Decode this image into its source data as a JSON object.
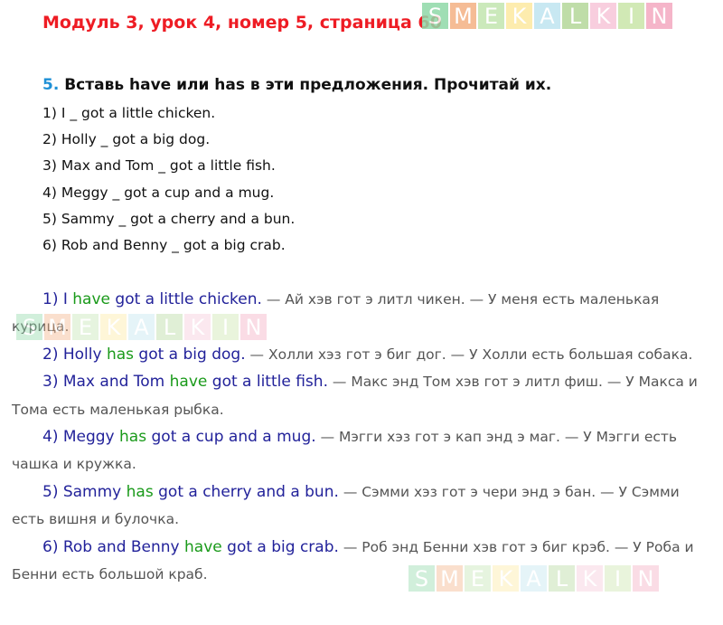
{
  "header": {
    "title": "Модуль 3, урок 4, номер 5, страница 60"
  },
  "watermark": {
    "letters": [
      "S",
      "M",
      "E",
      "K",
      "A",
      "L",
      "K",
      "I",
      "N"
    ],
    "colors": [
      "#8fd9a8",
      "#f4b183",
      "#c3e6b0",
      "#fde9a0",
      "#bfe4f0",
      "#b4d89a",
      "#f7c6d9",
      "#c9e6a9",
      "#f4a9c0"
    ]
  },
  "task": {
    "number": "5.",
    "instruction": "Вставь have или has в эти предложения. Прочитай их."
  },
  "questions": [
    "1) I _ got a little chicken.",
    "2) Holly _ got a big dog.",
    "3) Max and Tom _ got a little fish.",
    "4) Meggy _ got a cup and a mug.",
    "5) Sammy _ got a cherry and a bun.",
    "6) Rob and Benny _ got a big crab."
  ],
  "answers": [
    {
      "pre": "1) I ",
      "verb": "have",
      "post": " got a little chicken.",
      "translation": " — Ай хэв гот э литл чикен. — У меня есть маленькая курица."
    },
    {
      "pre": "2) Holly ",
      "verb": "has",
      "post": " got a big dog.",
      "translation": " — Холли хэз гот э биг дог. — У Холли есть большая собака."
    },
    {
      "pre": "3) Max and Tom ",
      "verb": "have",
      "post": " got a little fish.",
      "translation": " — Макс энд Том хэв гот э литл фиш. — У Макса и Тома есть маленькая рыбка."
    },
    {
      "pre": "4) Meggy ",
      "verb": "has",
      "post": " got a cup and a mug.",
      "translation": " — Мэгги хэз гот э кап энд э маг. — У Мэгги есть чашка и кружка."
    },
    {
      "pre": "5) Sammy ",
      "verb": "has",
      "post": " got a cherry and a bun.",
      "translation": " — Сэмми хэз гот э чери энд э бан. — У Сэмми есть вишня и булочка."
    },
    {
      "pre": "6)  Rob and Benny ",
      "verb": "have",
      "post": " got a big crab.",
      "translation": " — Роб энд Бенни хэв гот э биг крэб. — У Роба и Бенни есть большой краб."
    }
  ]
}
